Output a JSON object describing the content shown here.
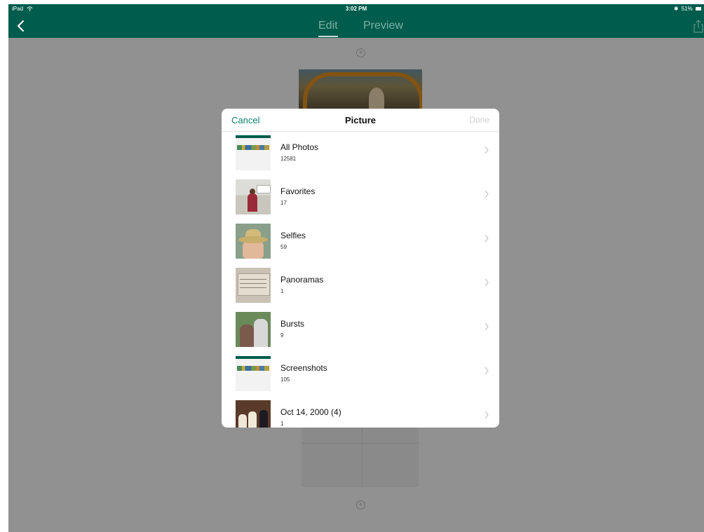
{
  "status_bar": {
    "device": "iPad",
    "time": "3:02 PM",
    "battery": "51%"
  },
  "nav": {
    "tab_edit": "Edit",
    "tab_preview": "Preview",
    "active_tab": "Edit"
  },
  "modal": {
    "cancel_label": "Cancel",
    "title": "Picture",
    "done_label": "Done"
  },
  "albums": [
    {
      "name": "All Photos",
      "count": "12581",
      "thumb": "screenshot"
    },
    {
      "name": "Favorites",
      "count": "17",
      "thumb": "favorites"
    },
    {
      "name": "Selfies",
      "count": "59",
      "thumb": "selfie"
    },
    {
      "name": "Panoramas",
      "count": "1",
      "thumb": "panorama"
    },
    {
      "name": "Bursts",
      "count": "9",
      "thumb": "burst"
    },
    {
      "name": "Screenshots",
      "count": "105",
      "thumb": "screenshot"
    },
    {
      "name": "Oct 14, 2000 (4)",
      "count": "1",
      "thumb": "event"
    }
  ],
  "colors": {
    "nav_bar": "#005c4c",
    "accent": "#0d7f6c",
    "done_disabled": "#cfcfcf"
  },
  "icons": {
    "back": "chevron-left-icon",
    "share": "share-icon",
    "row_disclosure": "chevron-right-icon",
    "add": "plus-circle-icon"
  }
}
